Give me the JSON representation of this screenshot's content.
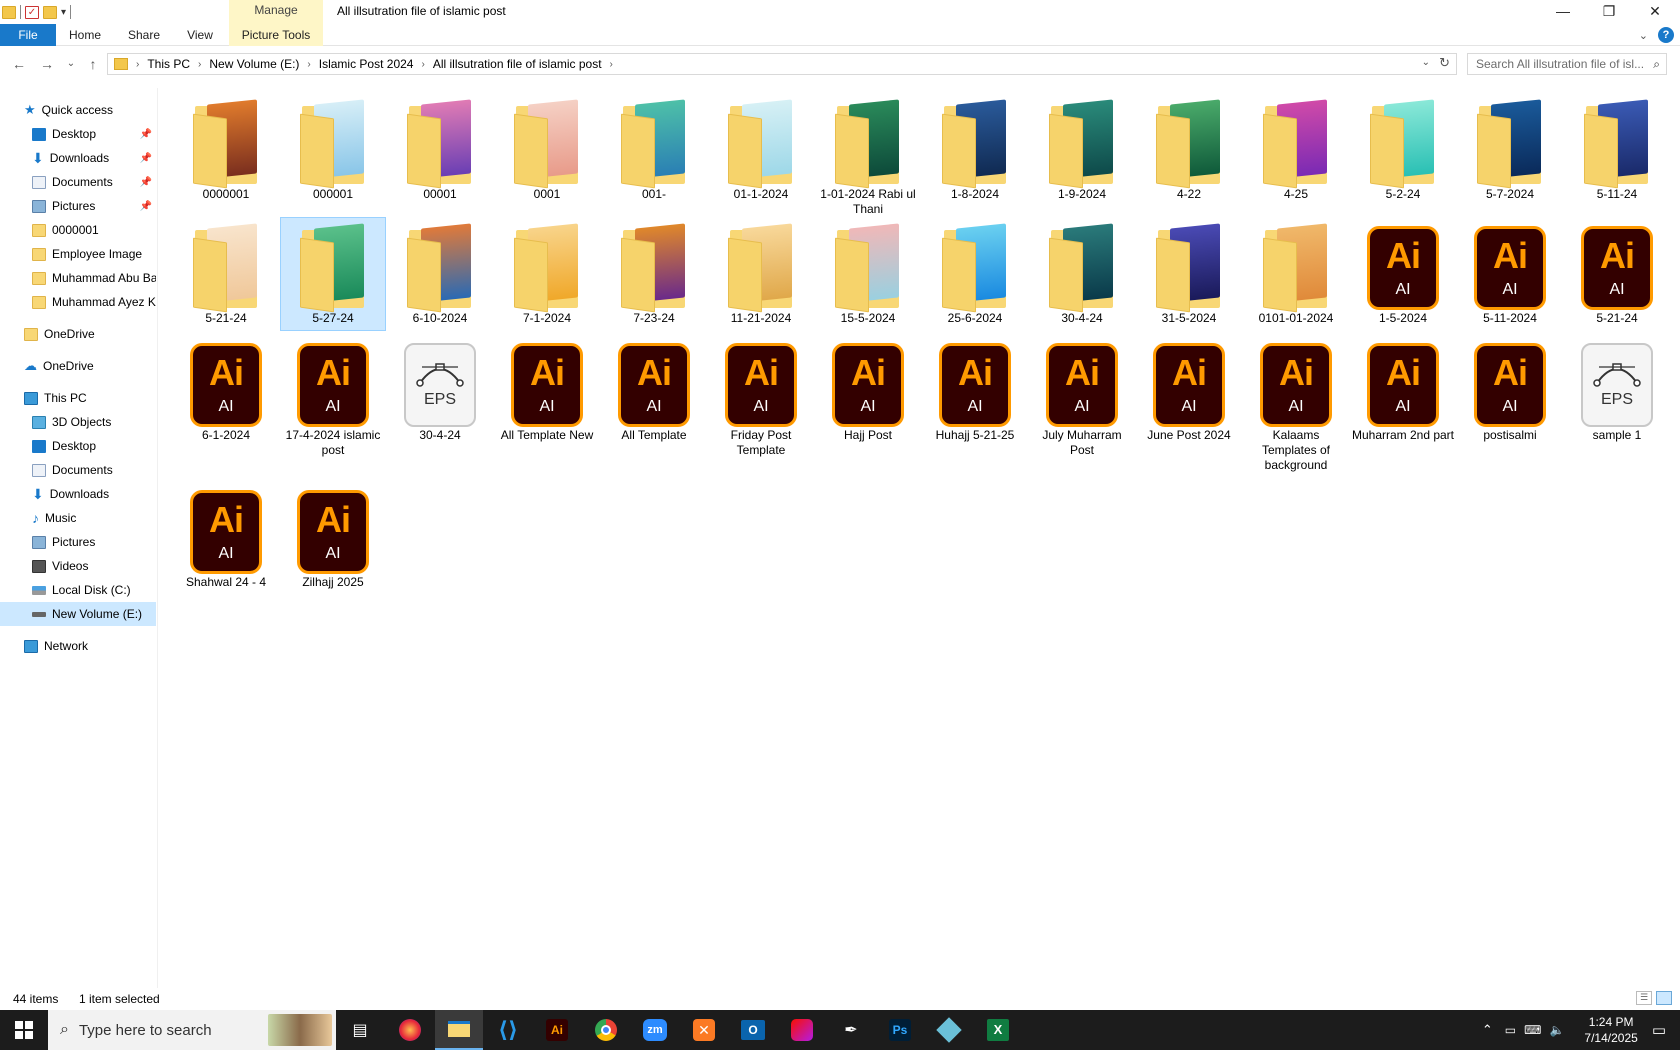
{
  "window": {
    "title": "All illsutration file of islamic post",
    "manage_tab": "Manage"
  },
  "ribbon": {
    "file": "File",
    "home": "Home",
    "share": "Share",
    "view": "View",
    "picture_tools": "Picture Tools"
  },
  "address": {
    "crumbs": [
      "This PC",
      "New Volume (E:)",
      "Islamic Post 2024",
      "All illsutration file of islamic post"
    ],
    "search_placeholder": "Search All illsutration file of isl..."
  },
  "nav": {
    "quick_access": "Quick access",
    "qa_items": [
      "Desktop",
      "Downloads",
      "Documents",
      "Pictures",
      "0000001",
      "Employee Image",
      "Muhammad Abu Ba",
      "Muhammad Ayez K"
    ],
    "onedrive1": "OneDrive",
    "onedrive2": "OneDrive",
    "this_pc": "This PC",
    "pc_items": [
      "3D Objects",
      "Desktop",
      "Documents",
      "Downloads",
      "Music",
      "Pictures",
      "Videos",
      "Local Disk (C:)",
      "New Volume (E:)"
    ],
    "network": "Network"
  },
  "files": [
    {
      "name": "0000001",
      "type": "folder",
      "colors": [
        "#7a2e1e",
        "#e07b2c"
      ]
    },
    {
      "name": "000001",
      "type": "folder",
      "colors": [
        "#8ac6e8",
        "#d6eef7"
      ]
    },
    {
      "name": "00001",
      "type": "folder",
      "colors": [
        "#6a3fb4",
        "#e07bb4"
      ]
    },
    {
      "name": "0001",
      "type": "folder",
      "colors": [
        "#e89b8a",
        "#f5d0c4"
      ]
    },
    {
      "name": "001-",
      "type": "folder",
      "colors": [
        "#2a7fb4",
        "#4ec0a8"
      ]
    },
    {
      "name": "01-1-2024",
      "type": "folder",
      "colors": [
        "#9ed8e8",
        "#d6f0f5"
      ]
    },
    {
      "name": "1-01-2024 Rabi ul Thani",
      "type": "folder",
      "colors": [
        "#0d4a3a",
        "#2a8a5a"
      ]
    },
    {
      "name": "1-8-2024",
      "type": "folder",
      "colors": [
        "#102a52",
        "#2a5a9a"
      ]
    },
    {
      "name": "1-9-2024",
      "type": "folder",
      "colors": [
        "#0e4a4a",
        "#2a8a7a"
      ]
    },
    {
      "name": "4-22",
      "type": "folder",
      "colors": [
        "#0f5a3a",
        "#4aaa6a"
      ]
    },
    {
      "name": "4-25",
      "type": "folder",
      "colors": [
        "#7a2ab4",
        "#d04aa8"
      ]
    },
    {
      "name": "5-2-24",
      "type": "folder",
      "colors": [
        "#2ac0b4",
        "#8ae8d8"
      ]
    },
    {
      "name": "5-7-2024",
      "type": "folder",
      "colors": [
        "#0a2a5a",
        "#1a5a9a"
      ]
    },
    {
      "name": "5-11-24",
      "type": "folder",
      "colors": [
        "#1a2a6a",
        "#3a5ab4"
      ]
    },
    {
      "name": "5-21-24",
      "type": "folder",
      "colors": [
        "#f0c89a",
        "#f8e4cc"
      ]
    },
    {
      "name": "5-27-24",
      "type": "folder",
      "colors": [
        "#1a8a5a",
        "#5ac08a"
      ],
      "selected": true
    },
    {
      "name": "6-10-2024",
      "type": "folder",
      "colors": [
        "#2a6ab4",
        "#e07a3a"
      ]
    },
    {
      "name": "7-1-2024",
      "type": "folder",
      "colors": [
        "#f0a82a",
        "#f8d48a"
      ]
    },
    {
      "name": "7-23-24",
      "type": "folder",
      "colors": [
        "#6a2a8a",
        "#e0882a"
      ]
    },
    {
      "name": "11-21-2024",
      "type": "folder",
      "colors": [
        "#e0a84a",
        "#f8d89a"
      ]
    },
    {
      "name": "15-5-2024",
      "type": "folder",
      "colors": [
        "#9ad0e0",
        "#f0b8b8"
      ]
    },
    {
      "name": "25-6-2024",
      "type": "folder",
      "colors": [
        "#1a8ae0",
        "#6ad0f0"
      ]
    },
    {
      "name": "30-4-24",
      "type": "folder",
      "colors": [
        "#0a3a4a",
        "#2a7a7a"
      ]
    },
    {
      "name": "31-5-2024",
      "type": "folder",
      "colors": [
        "#1a1a5a",
        "#4a4ab4"
      ]
    },
    {
      "name": "0101-01-2024",
      "type": "folder",
      "colors": [
        "#e08a3a",
        "#f0b86a"
      ]
    },
    {
      "name": "1-5-2024",
      "type": "ai"
    },
    {
      "name": "5-11-2024",
      "type": "ai"
    },
    {
      "name": "5-21-24",
      "type": "ai"
    },
    {
      "name": "6-1-2024",
      "type": "ai"
    },
    {
      "name": "17-4-2024 islamic post",
      "type": "ai"
    },
    {
      "name": "30-4-24",
      "type": "eps"
    },
    {
      "name": "All Template New",
      "type": "ai"
    },
    {
      "name": "All Template",
      "type": "ai"
    },
    {
      "name": "Friday Post Template",
      "type": "ai"
    },
    {
      "name": "Hajj Post",
      "type": "ai"
    },
    {
      "name": "Huhajj 5-21-25",
      "type": "ai"
    },
    {
      "name": "July Muharram Post",
      "type": "ai"
    },
    {
      "name": "June Post 2024",
      "type": "ai"
    },
    {
      "name": "Kalaams Templates of background",
      "type": "ai"
    },
    {
      "name": "Muharram 2nd part",
      "type": "ai"
    },
    {
      "name": "postisalmi",
      "type": "ai"
    },
    {
      "name": "sample 1",
      "type": "eps"
    },
    {
      "name": "Shahwal 24 - 4",
      "type": "ai"
    },
    {
      "name": "Zilhajj 2025",
      "type": "ai"
    }
  ],
  "icon_text": {
    "ai_big": "Ai",
    "ai_small": "AI",
    "eps_small": "EPS"
  },
  "status": {
    "count": "44 items",
    "selected": "1 item selected"
  },
  "taskbar": {
    "search_placeholder": "Type here to search",
    "time": "1:24 PM",
    "date": "7/14/2025"
  },
  "colors": {
    "accent": "#1979ca",
    "selection": "#cce8ff",
    "ai_bg": "#330000",
    "ai_orange": "#ff9a00"
  }
}
